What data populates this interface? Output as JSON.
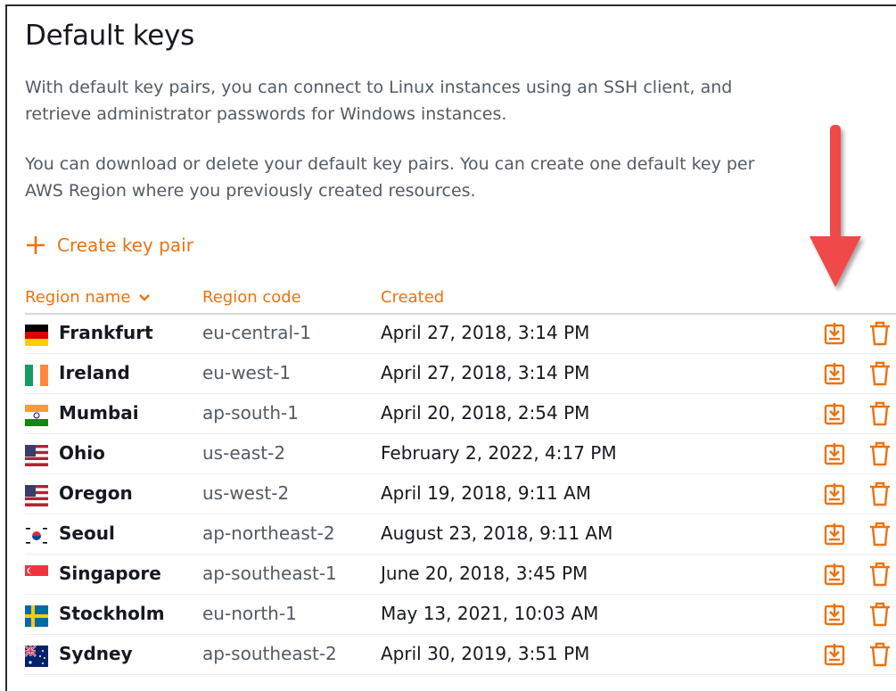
{
  "page": {
    "title": "Default keys",
    "description1": "With default key pairs, you can connect to Linux instances using an SSH client, and retrieve administrator passwords for Windows instances.",
    "description2": "You can download or delete your default key pairs. You can create one default key per AWS Region where you previously created resources.",
    "create_label": "Create key pair"
  },
  "columns": {
    "region_name": "Region name",
    "region_code": "Region code",
    "created": "Created"
  },
  "accent_color": "#ec7211",
  "annotation_arrow_color": "#f04848",
  "rows": [
    {
      "name": "Frankfurt",
      "code": "eu-central-1",
      "created": "April 27, 2018, 3:14 PM",
      "flag": "germany-flag"
    },
    {
      "name": "Ireland",
      "code": "eu-west-1",
      "created": "April 27, 2018, 3:14 PM",
      "flag": "ireland-flag"
    },
    {
      "name": "Mumbai",
      "code": "ap-south-1",
      "created": "April 20, 2018, 2:54 PM",
      "flag": "india-flag"
    },
    {
      "name": "Ohio",
      "code": "us-east-2",
      "created": "February 2, 2022, 4:17 PM",
      "flag": "usa-flag"
    },
    {
      "name": "Oregon",
      "code": "us-west-2",
      "created": "April 19, 2018, 9:11 AM",
      "flag": "usa-flag"
    },
    {
      "name": "Seoul",
      "code": "ap-northeast-2",
      "created": "August 23, 2018, 9:11 AM",
      "flag": "south-korea-flag"
    },
    {
      "name": "Singapore",
      "code": "ap-southeast-1",
      "created": "June 20, 2018, 3:45 PM",
      "flag": "singapore-flag"
    },
    {
      "name": "Stockholm",
      "code": "eu-north-1",
      "created": "May 13, 2021, 10:03 AM",
      "flag": "sweden-flag"
    },
    {
      "name": "Sydney",
      "code": "ap-southeast-2",
      "created": "April 30, 2019, 3:51 PM",
      "flag": "australia-flag"
    }
  ]
}
